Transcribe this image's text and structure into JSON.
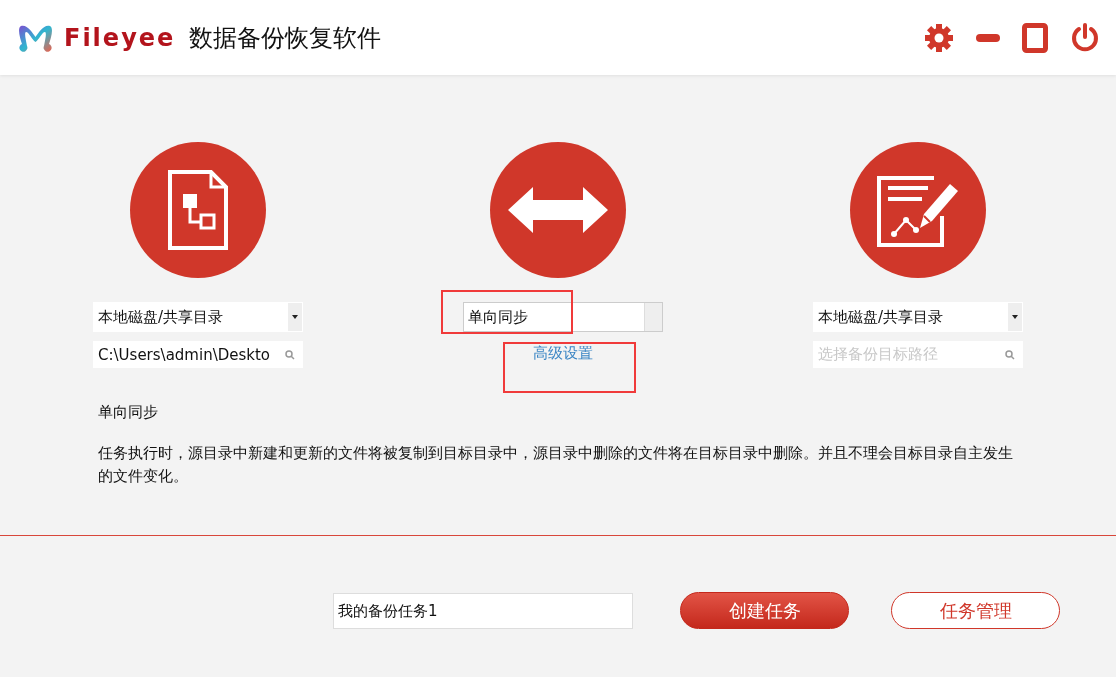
{
  "app": {
    "logo_text": "Fileyee",
    "title": "数据备份恢复软件"
  },
  "source": {
    "type_dropdown": "本地磁盘/共享目录",
    "path": "C:\\Users\\admin\\Deskto"
  },
  "mode": {
    "dropdown": "单向同步",
    "highlighted": true,
    "advanced_link": "高级设置",
    "link_highlighted": true
  },
  "target": {
    "type_dropdown": "本地磁盘/共享目录",
    "path_placeholder": "选择备份目标路径"
  },
  "description": {
    "title": "单向同步",
    "text": "任务执行时，源目录中新建和更新的文件将被复制到目标目录中，源目录中删除的文件将在目标目录中删除。并且不理会目标目录自主发生的文件变化。"
  },
  "task_name": "我的备份任务1",
  "buttons": [
    {
      "label": "创建任务",
      "kind": "primary"
    },
    {
      "label": "任务管理",
      "kind": "outline"
    }
  ]
}
